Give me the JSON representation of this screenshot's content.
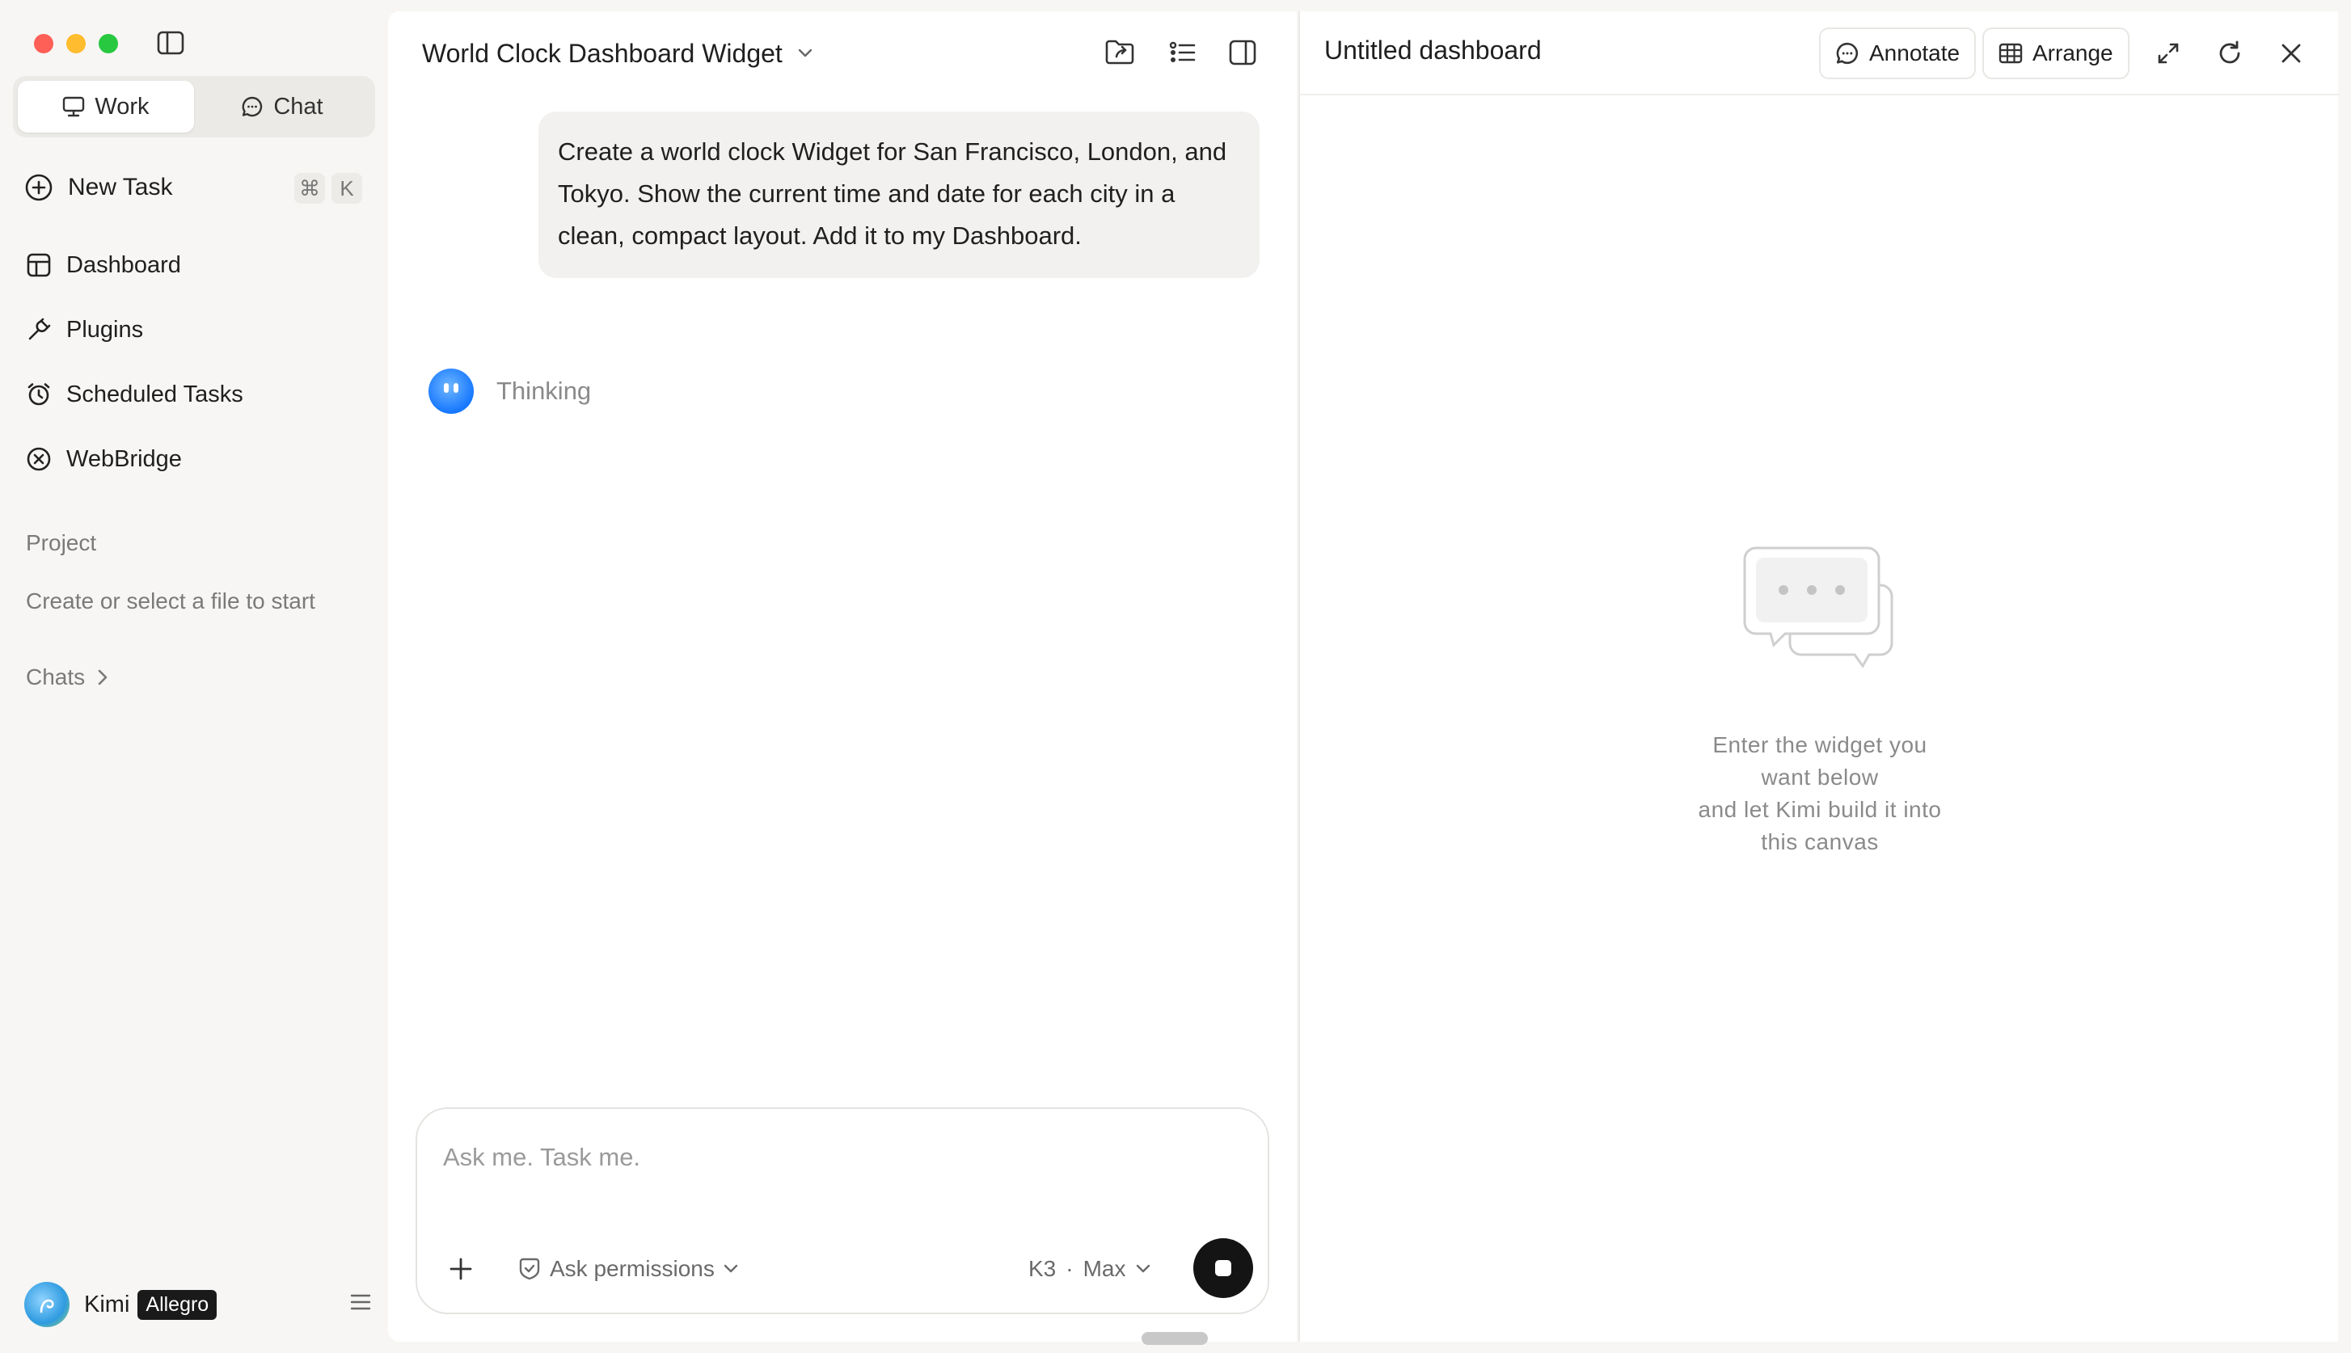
{
  "sidebar": {
    "modes": {
      "work": "Work",
      "chat": "Chat"
    },
    "new_task": {
      "label": "New Task",
      "shortcut_cmd": "⌘",
      "shortcut_key": "K"
    },
    "nav": [
      {
        "label": "Dashboard",
        "icon": "dashboard-icon"
      },
      {
        "label": "Plugins",
        "icon": "plug-icon"
      },
      {
        "label": "Scheduled Tasks",
        "icon": "alarm-clock-icon"
      },
      {
        "label": "WebBridge",
        "icon": "webbridge-icon"
      }
    ],
    "project_label": "Project",
    "project_empty": "Create or select a file to start",
    "chats_label": "Chats",
    "user": {
      "name": "Kimi",
      "plan": "Allegro"
    }
  },
  "chat": {
    "title": "World Clock Dashboard Widget",
    "user_message": "Create a world clock Widget for San Francisco, London, and Tokyo. Show the current time and date for each city in a clean, compact layout. Add it to my Dashboard.",
    "status": "Thinking",
    "composer": {
      "placeholder": "Ask me. Task me.",
      "permissions": "Ask permissions",
      "model": "K3",
      "separator": "·",
      "mode": "Max"
    }
  },
  "dashboard": {
    "title": "Untitled dashboard",
    "annotate": "Annotate",
    "arrange": "Arrange",
    "empty_lines": [
      "Enter the widget you",
      "want below",
      "and let Kimi build it into",
      "this canvas"
    ]
  },
  "colors": {
    "traffic_red": "#fe5f57",
    "traffic_yellow": "#febc2e",
    "traffic_green": "#28c840",
    "stop_button": "#141414",
    "kimi_blue": "#1677ff"
  }
}
